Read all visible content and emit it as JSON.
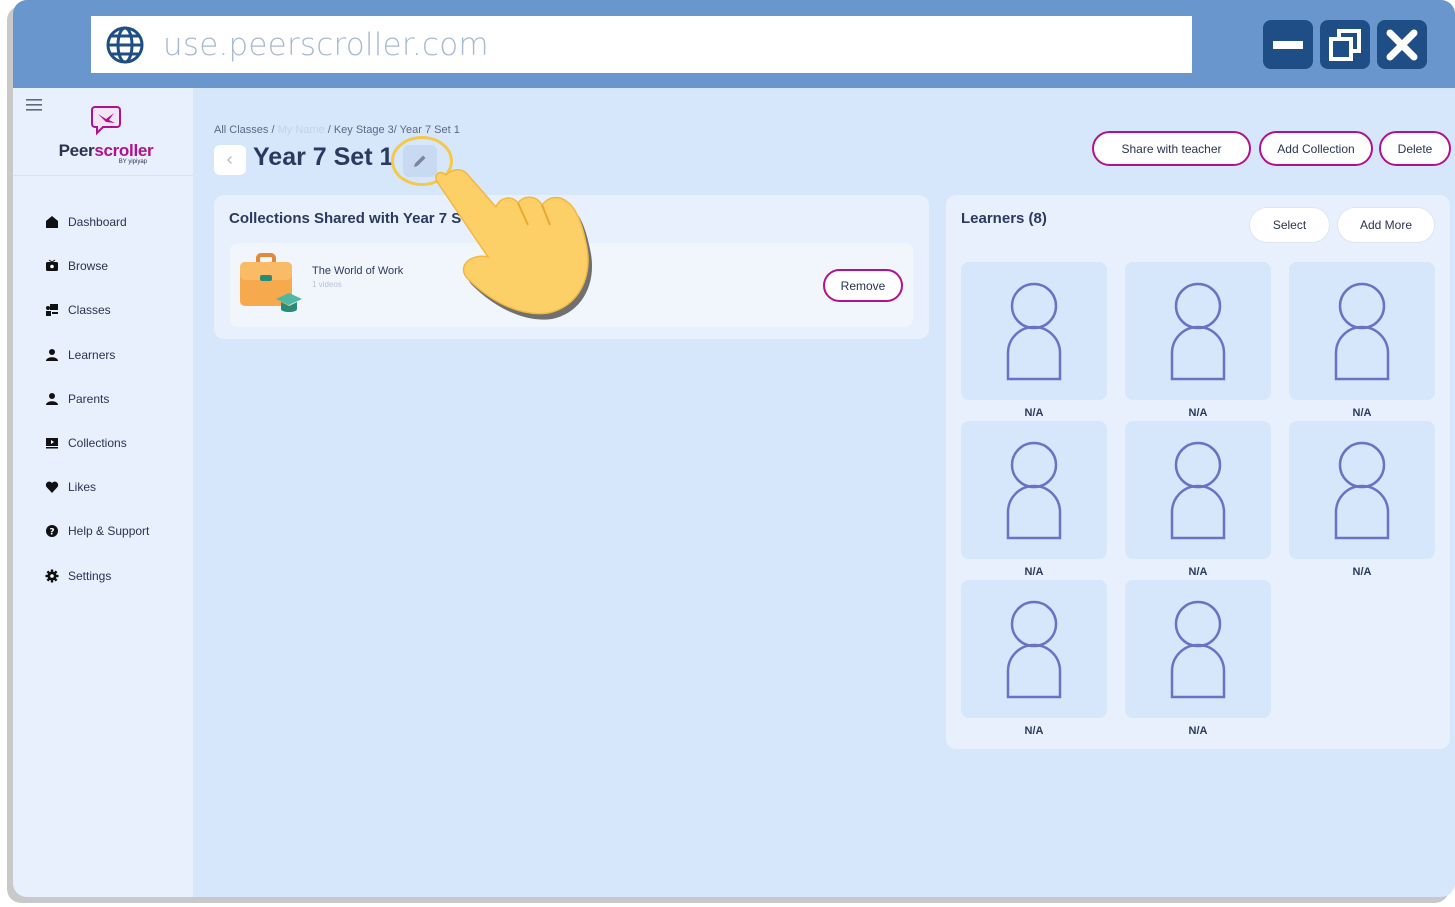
{
  "browser": {
    "url": "use.peerscroller.com"
  },
  "logo": {
    "text_a": "Peer",
    "text_b": "scroller",
    "by": "BY yipiyap"
  },
  "sidebar": {
    "items": [
      {
        "label": "Dashboard",
        "icon": "home-icon"
      },
      {
        "label": "Browse",
        "icon": "tv-icon"
      },
      {
        "label": "Classes",
        "icon": "classroom-icon"
      },
      {
        "label": "Learners",
        "icon": "person-icon"
      },
      {
        "label": "Parents",
        "icon": "person-icon"
      },
      {
        "label": "Collections",
        "icon": "playlist-icon"
      },
      {
        "label": "Likes",
        "icon": "heart-icon"
      },
      {
        "label": "Help & Support",
        "icon": "help-icon"
      },
      {
        "label": "Settings",
        "icon": "gear-icon"
      }
    ]
  },
  "breadcrumb": {
    "all_classes": "All Classes /",
    "my_name": "My Name",
    "rest": "/ Key Stage 3/ Year 7 Set 1"
  },
  "page": {
    "title": "Year 7 Set 1"
  },
  "actions": {
    "share": "Share with teacher",
    "add_collection": "Add Collection",
    "delete": "Delete"
  },
  "collections_panel": {
    "title": "Collections Shared with Year 7 S",
    "items": [
      {
        "name": "The World of Work",
        "meta": "1 videos",
        "remove_label": "Remove"
      }
    ]
  },
  "learners_panel": {
    "title": "Learners (8)",
    "select_label": "Select",
    "add_more_label": "Add More",
    "learners": [
      "N/A",
      "N/A",
      "N/A",
      "N/A",
      "N/A",
      "N/A",
      "N/A",
      "N/A"
    ]
  },
  "colors": {
    "topbar": "#6996cc",
    "accent": "#b0128f",
    "window_button": "#1f4e86",
    "background": "#d6e6fb"
  }
}
